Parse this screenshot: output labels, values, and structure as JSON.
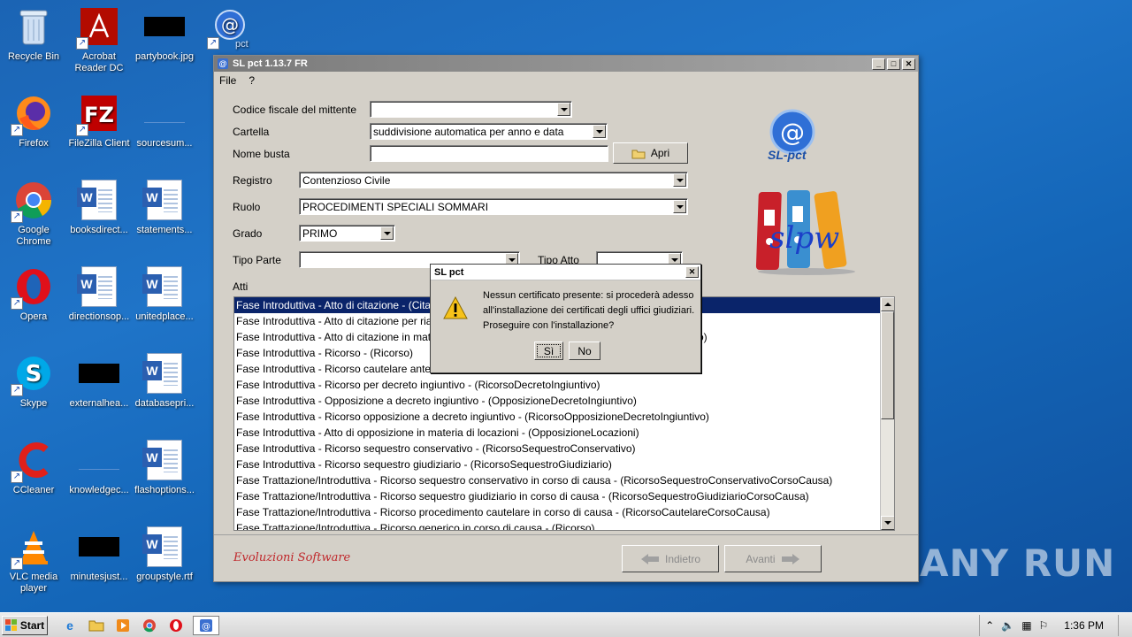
{
  "desktop": {
    "icons": [
      {
        "label": "Recycle Bin"
      },
      {
        "label": "Acrobat Reader DC"
      },
      {
        "label": "partybook.jpg"
      },
      {
        "label": "Firefox"
      },
      {
        "label": "FileZilla Client"
      },
      {
        "label": "sourcesum..."
      },
      {
        "label": "Google Chrome"
      },
      {
        "label": "booksdirect..."
      },
      {
        "label": "statements..."
      },
      {
        "label": "Opera"
      },
      {
        "label": "directionsop..."
      },
      {
        "label": "unitedplace..."
      },
      {
        "label": "Skype"
      },
      {
        "label": "externalhea..."
      },
      {
        "label": "databasepri..."
      },
      {
        "label": "CCleaner"
      },
      {
        "label": "knowledgec..."
      },
      {
        "label": "flashoptions..."
      },
      {
        "label": "VLC media player"
      },
      {
        "label": "minutesjust..."
      },
      {
        "label": "groupstyle.rtf"
      }
    ],
    "pct_icon_label": "pct"
  },
  "window": {
    "title": "SL pct 1.13.7 FR",
    "menu": [
      "File",
      "?"
    ],
    "form": {
      "codice_label": "Codice fiscale del mittente",
      "codice_value": "",
      "cartella_label": "Cartella",
      "cartella_value": "suddivisione automatica per anno e data",
      "nome_busta_label": "Nome busta",
      "nome_busta_value": "",
      "apri_label": "Apri",
      "registro_label": "Registro",
      "registro_value": "Contenzioso Civile",
      "ruolo_label": "Ruolo",
      "ruolo_value": "PROCEDIMENTI SPECIALI SOMMARI",
      "grado_label": "Grado",
      "grado_value": "PRIMO",
      "tipo_parte_label": "Tipo Parte",
      "tipo_parte_value": "",
      "tipo_atto_label": "Tipo Atto",
      "tipo_atto_value": "",
      "atti_label": "Atti"
    },
    "logo_text": "SL-pct",
    "slpw_text": "slpw",
    "atti": [
      "Fase Introduttiva - Atto di citazione - (Citazione)",
      "Fase Introduttiva - Atto di citazione per ria",
      "Fase Introduttiva - Atto di citazione in mat",
      "Fase Introduttiva - Ricorso - (Ricorso)",
      "Fase Introduttiva - Ricorso cautelare ante",
      "Fase Introduttiva - Ricorso per decreto ingiuntivo - (RicorsoDecretoIngiuntivo)",
      "Fase Introduttiva - Opposizione a decreto ingiuntivo - (OpposizioneDecretoIngiuntivo)",
      "Fase Introduttiva - Ricorso opposizione a decreto ingiuntivo - (RicorsoOpposizioneDecretoIngiuntivo)",
      "Fase Introduttiva - Atto di opposizione in materia di locazioni - (OpposizioneLocazioni)",
      "Fase Introduttiva - Ricorso sequestro conservativo - (RicorsoSequestroConservativo)",
      "Fase Introduttiva - Ricorso sequestro giudiziario - (RicorsoSequestroGiudiziario)",
      "Fase Trattazione/Introduttiva - Ricorso sequestro conservativo in corso di causa - (RicorsoSequestroConservativoCorsoCausa)",
      "Fase Trattazione/Introduttiva - Ricorso sequestro giudiziario in corso di causa - (RicorsoSequestroGiudiziarioCorsoCausa)",
      "Fase Trattazione/Introduttiva - Ricorso procedimento cautelare in corso di causa - (RicorsoCautelareCorsoCausa)",
      "Fase Trattazione/Introduttiva - Ricorso generico in corso di causa - (Ricorso)"
    ],
    "row2_tail": "o)",
    "brand": "Evoluzioni Software",
    "indietro_label": "Indietro",
    "avanti_label": "Avanti"
  },
  "dialog": {
    "title": "SL pct",
    "message_line1": "Nessun certificato presente: si procederà adesso",
    "message_line2": "all'installazione dei certificati degli uffici giudiziari.",
    "message_line3": "Proseguire con l'installazione?",
    "yes_label": "Sì",
    "no_label": "No"
  },
  "taskbar": {
    "start_label": "Start",
    "clock": "1:36 PM"
  },
  "watermark": "ANY RUN"
}
